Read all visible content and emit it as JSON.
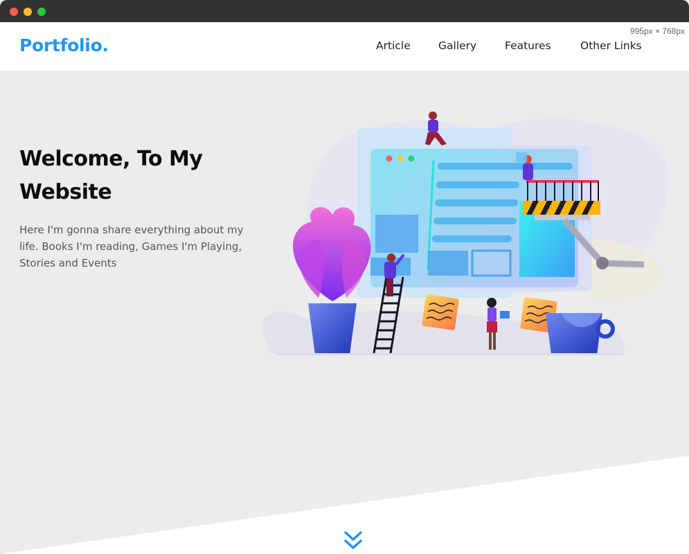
{
  "window": {
    "size_badge": "995px × 768px"
  },
  "navbar": {
    "logo": "Portfolio.",
    "links": [
      {
        "label": "Article"
      },
      {
        "label": "Gallery"
      },
      {
        "label": "Features"
      },
      {
        "label": "Other Links"
      }
    ]
  },
  "hero": {
    "title": "Welcome, To My Website",
    "text": "Here I'm gonna share everything about my life. Books I'm reading, Games I'm Playing, Stories and Events"
  },
  "icons": {
    "illustration": "website-building-illustration",
    "scroll": "double-chevron-down-icon"
  },
  "colors": {
    "brand": "#2196f3",
    "hero_bg": "#ececec",
    "nav_bg": "#ffffff"
  }
}
